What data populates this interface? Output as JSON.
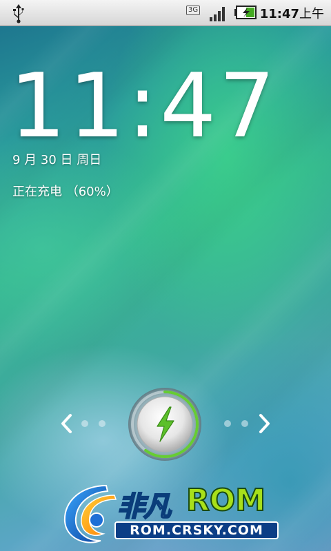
{
  "status_bar": {
    "network_type": "3G",
    "time": "11:47",
    "ampm": "上午",
    "icons": [
      "usb-icon",
      "signal-icon",
      "battery-charging-icon"
    ]
  },
  "lockscreen": {
    "time": "11:47",
    "date": "9 月 30 日 周日",
    "charging_status": "正在充电 （60%）",
    "battery_level_percent": 60,
    "unlock_icon": "lightning-bolt-icon"
  },
  "watermark": {
    "brand_cn": "非凡",
    "brand_rom": "ROM",
    "url": "ROM.CRSKY.COM"
  },
  "colors": {
    "accent_green": "#5cc02a",
    "ring_green": "#66cc33"
  }
}
